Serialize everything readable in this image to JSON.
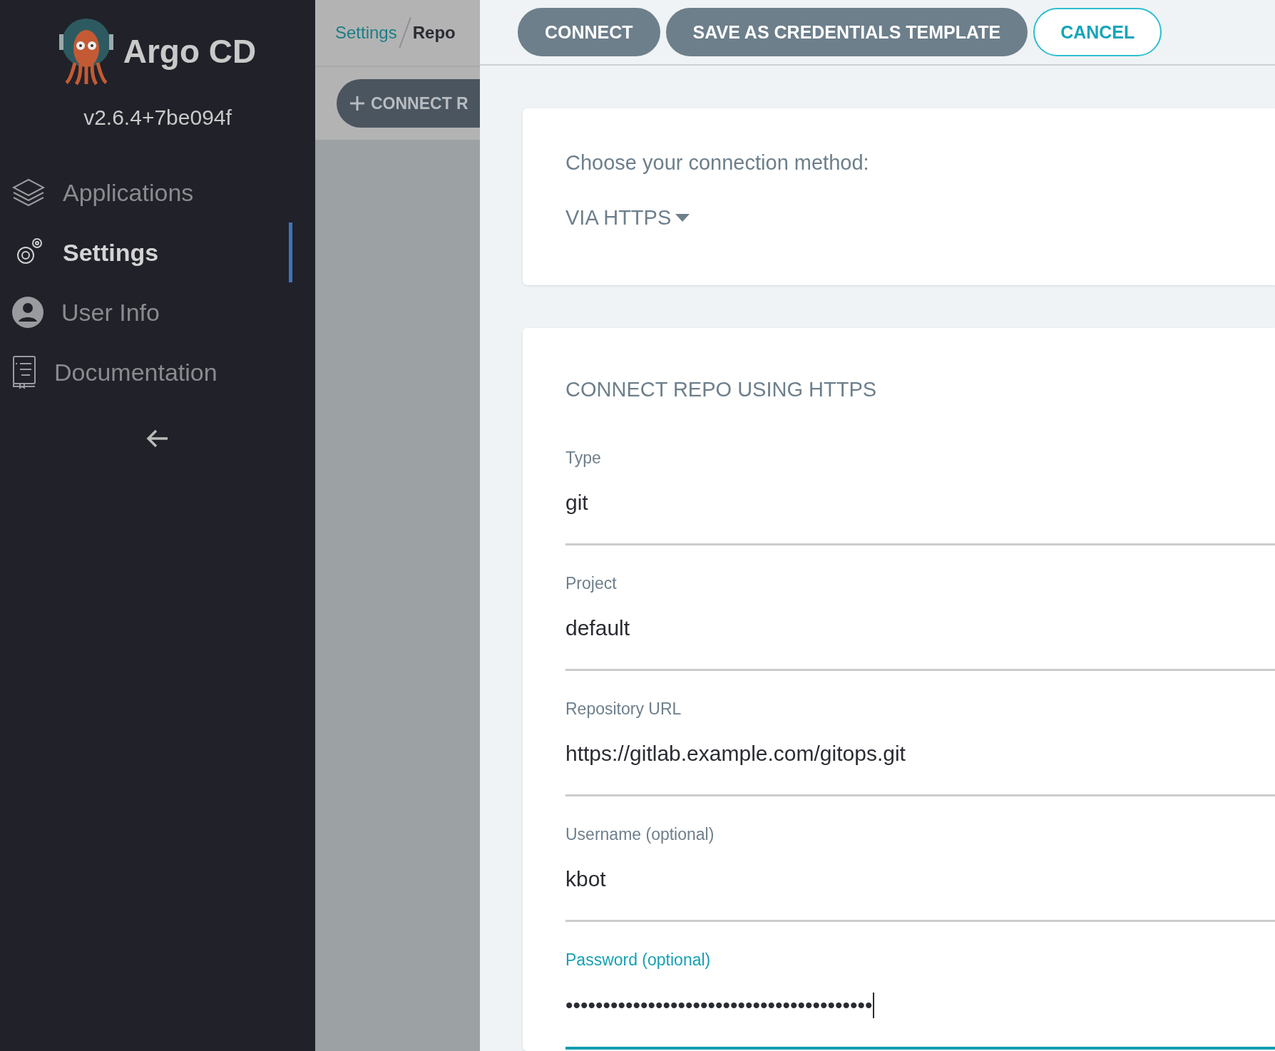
{
  "sidebar": {
    "brand": "Argo CD",
    "version": "v2.6.4+7be094f",
    "items": [
      {
        "kind": "layers",
        "label": "Applications",
        "selected": false
      },
      {
        "kind": "gear",
        "label": "Settings",
        "selected": true
      },
      {
        "kind": "user",
        "label": "User Info",
        "selected": false
      },
      {
        "kind": "book",
        "label": "Documentation",
        "selected": false
      }
    ]
  },
  "background": {
    "breadcrumbs": [
      "Settings",
      "Repo"
    ],
    "button": "CONNECT R"
  },
  "toolbar": {
    "buttons": [
      {
        "kind": "filled",
        "label": "CONNECT"
      },
      {
        "kind": "filled",
        "label": "SAVE AS CREDENTIALS TEMPLATE"
      },
      {
        "kind": "outline",
        "label": "CANCEL"
      }
    ]
  },
  "method_card": {
    "prompt": "Choose your connection method:",
    "method": "VIA HTTPS"
  },
  "form": {
    "title": "CONNECT REPO USING HTTPS",
    "fields": [
      {
        "label": "Type",
        "value": "git",
        "focused": false
      },
      {
        "label": "Project",
        "value": "default",
        "focused": false
      },
      {
        "label": "Repository URL",
        "value": "https://gitlab.example.com/gitops.git",
        "focused": false
      },
      {
        "label": "Username (optional)",
        "value": "kbot",
        "focused": false
      },
      {
        "label": "Password (optional)",
        "value": "•••••••••••••••••••••••••••••••••••••••••",
        "focused": true
      }
    ]
  }
}
